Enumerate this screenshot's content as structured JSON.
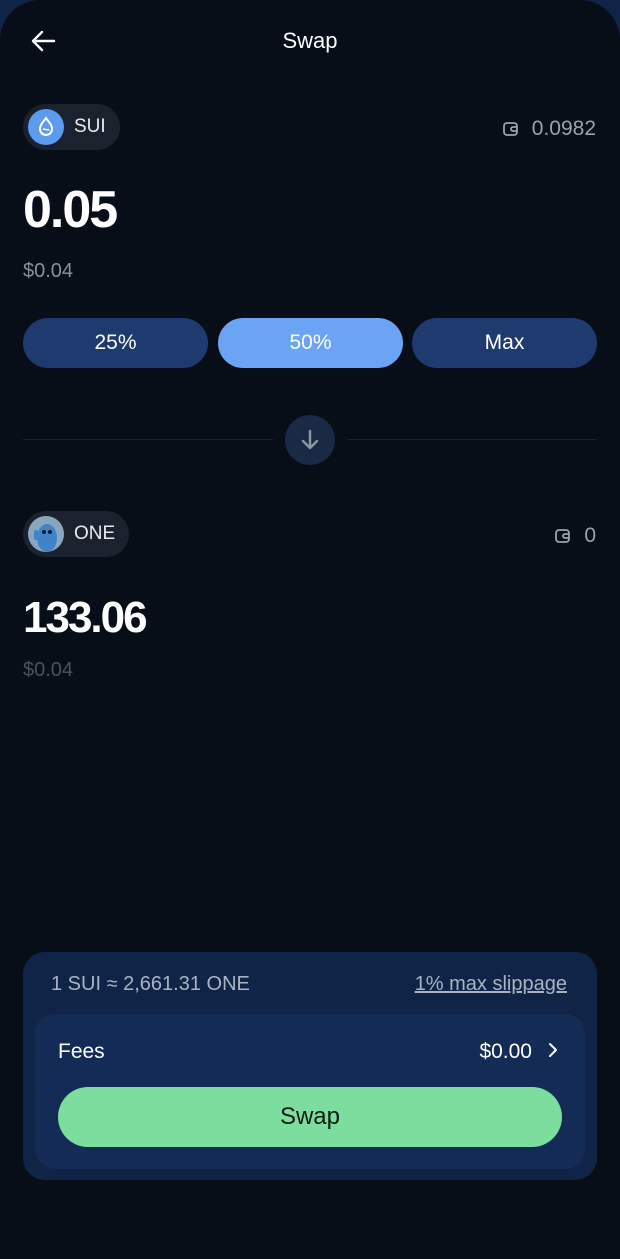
{
  "header": {
    "title": "Swap",
    "back_icon": "arrow-left-icon"
  },
  "from": {
    "symbol": "SUI",
    "icon": "sui-droplet-icon",
    "icon_color": "#5b9cf0",
    "balance": "0.0982",
    "amount": "0.05",
    "usd": "$0.04"
  },
  "percent_buttons": [
    {
      "label": "25%",
      "active": false
    },
    {
      "label": "50%",
      "active": true
    },
    {
      "label": "Max",
      "active": false
    }
  ],
  "switch_icon": "arrow-down-icon",
  "to": {
    "symbol": "ONE",
    "icon": "one-mascot-icon",
    "balance": "0",
    "amount": "133.06",
    "usd": "$0.04"
  },
  "summary": {
    "rate": "1 SUI ≈ 2,661.31 ONE",
    "slippage": "1% max slippage",
    "fees_label": "Fees",
    "fees_value": "$0.00",
    "swap_label": "Swap"
  },
  "colors": {
    "background": "#080e18",
    "accent_blue": "#6ba4f5",
    "button_blue": "#1e3a6e",
    "panel": "#0f2447",
    "swap_green": "#7bde9e"
  }
}
